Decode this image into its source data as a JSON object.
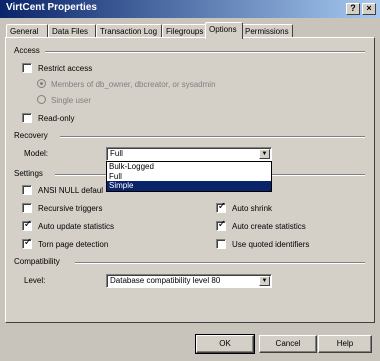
{
  "window": {
    "title": "VirtCent Properties",
    "help_glyph": "?",
    "close_glyph": "×"
  },
  "tabs": [
    {
      "label": "General"
    },
    {
      "label": "Data Files"
    },
    {
      "label": "Transaction Log"
    },
    {
      "label": "Filegroups"
    },
    {
      "label": "Options",
      "active": true
    },
    {
      "label": "Permissions"
    }
  ],
  "access": {
    "title": "Access",
    "restrict_access": "Restrict access",
    "members_option": "Members of db_owner, dbcreator, or sysadmin",
    "single_user": "Single user",
    "read_only": "Read-only"
  },
  "recovery": {
    "title": "Recovery",
    "model_label": "Model:",
    "model_value": "Full",
    "options": [
      "Bulk-Logged",
      "Full",
      "Simple"
    ],
    "highlighted": "Simple"
  },
  "settings": {
    "title": "Settings",
    "ansi_null": "ANSI NULL defaul",
    "recursive_triggers": "Recursive triggers",
    "auto_update_stats": "Auto update statistics",
    "torn_page": "Torn page detection",
    "auto_shrink": "Auto shrink",
    "auto_create_stats": "Auto create statistics",
    "quoted_identifiers": "Use quoted identifiers",
    "check_glyph": "✓"
  },
  "compatibility": {
    "title": "Compatibility",
    "level_label": "Level:",
    "level_value": "Database compatibility level 80",
    "arrow_glyph": "▼"
  },
  "buttons": {
    "ok": "OK",
    "cancel": "Cancel",
    "help": "Help"
  }
}
